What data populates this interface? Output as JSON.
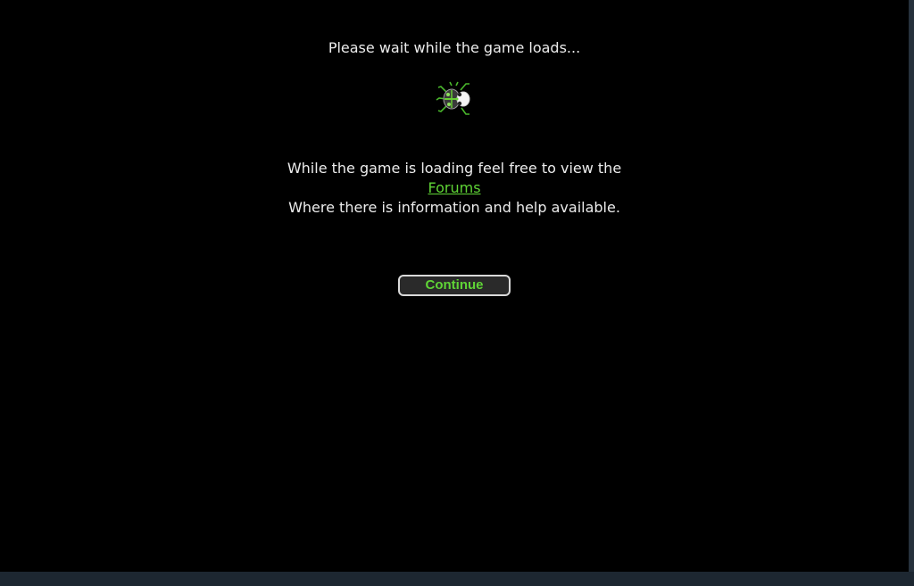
{
  "loading": {
    "message": "Please wait while the game loads...",
    "icon": "beetle-loading-icon"
  },
  "info": {
    "line1": "While the game is loading feel free to view the",
    "link": "Forums",
    "line2": "Where there is information and help available."
  },
  "actions": {
    "continue_label": "Continue"
  },
  "colors": {
    "background": "#000000",
    "text": "#ececec",
    "accent": "#5fd436",
    "frame": "#1e2832"
  }
}
